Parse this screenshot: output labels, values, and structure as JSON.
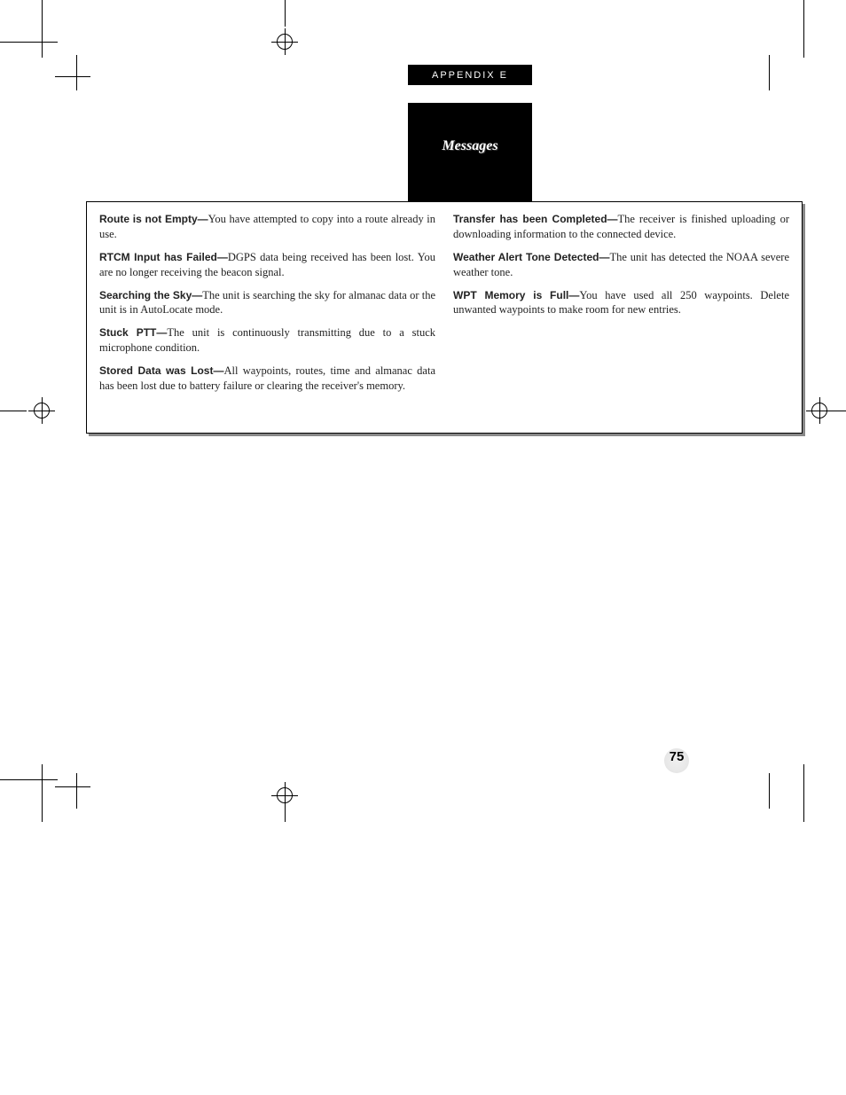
{
  "header": {
    "appendix": "APPENDIX E",
    "section": "Messages"
  },
  "left_col": [
    {
      "term": "Route is not Empty—",
      "desc": "You have attempted to copy into a route already in use."
    },
    {
      "term": "RTCM Input has Failed—",
      "desc": "DGPS data being received has been lost. You are no longer receiving the beacon signal."
    },
    {
      "term": "Searching the Sky—",
      "desc": "The unit is searching the sky for almanac data or the unit is in AutoLocate mode."
    },
    {
      "term": "Stuck PTT—",
      "desc": "The unit is continuously transmitting due to a stuck microphone condition."
    },
    {
      "term": "Stored Data was Lost—",
      "desc": "All waypoints, routes, time and almanac data has been lost due to battery failure or clearing the receiver's memory."
    }
  ],
  "right_col": [
    {
      "term": "Transfer has been Completed—",
      "desc": "The receiver is finished uploading or downloading information to the connected device."
    },
    {
      "term": "Weather Alert Tone Detected—",
      "desc": "The unit has detected the NOAA severe weather tone."
    },
    {
      "term": "WPT Memory is Full—",
      "desc": "You have used all 250 waypoints. Delete unwanted waypoints to make room for new entries."
    }
  ],
  "page_number": "75"
}
